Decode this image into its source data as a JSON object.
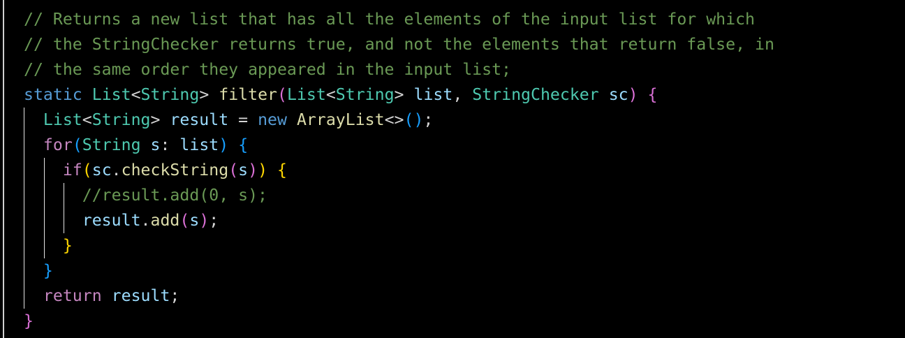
{
  "colors": {
    "background": "#000000",
    "comment": "#6a9955",
    "keyword": "#569cd6",
    "control": "#c586c0",
    "type": "#4ec9b0",
    "function": "#dcdcaa",
    "variable": "#9cdcfe",
    "plain": "#d4d4d4",
    "bracket_level_1": "#da70d6",
    "bracket_level_2": "#179fff",
    "bracket_level_3": "#ffd700"
  },
  "code": {
    "lines": [
      {
        "indent_guides": 0,
        "tokens": [
          {
            "t": "// Returns a new list that has all the elements of the input list for which",
            "c": "comment"
          }
        ]
      },
      {
        "indent_guides": 0,
        "tokens": [
          {
            "t": "// the StringChecker returns true, and not the elements that return false, in",
            "c": "comment"
          }
        ]
      },
      {
        "indent_guides": 0,
        "tokens": [
          {
            "t": "// the same order they appeared in the input list;",
            "c": "comment"
          }
        ]
      },
      {
        "indent_guides": 0,
        "tokens": [
          {
            "t": "static",
            "c": "keyword"
          },
          {
            "t": " ",
            "c": "plain"
          },
          {
            "t": "List",
            "c": "type"
          },
          {
            "t": "<",
            "c": "plain"
          },
          {
            "t": "String",
            "c": "type"
          },
          {
            "t": "> ",
            "c": "plain"
          },
          {
            "t": "filter",
            "c": "func"
          },
          {
            "t": "(",
            "c": "brace1"
          },
          {
            "t": "List",
            "c": "type"
          },
          {
            "t": "<",
            "c": "plain"
          },
          {
            "t": "String",
            "c": "type"
          },
          {
            "t": "> ",
            "c": "plain"
          },
          {
            "t": "list",
            "c": "variable"
          },
          {
            "t": ", ",
            "c": "plain"
          },
          {
            "t": "StringChecker",
            "c": "type"
          },
          {
            "t": " ",
            "c": "plain"
          },
          {
            "t": "sc",
            "c": "variable"
          },
          {
            "t": ")",
            "c": "brace1"
          },
          {
            "t": " ",
            "c": "plain"
          },
          {
            "t": "{",
            "c": "brace1"
          }
        ]
      },
      {
        "indent_guides": 1,
        "tokens": [
          {
            "t": "  ",
            "c": "plain"
          },
          {
            "t": "List",
            "c": "type"
          },
          {
            "t": "<",
            "c": "plain"
          },
          {
            "t": "String",
            "c": "type"
          },
          {
            "t": "> ",
            "c": "plain"
          },
          {
            "t": "result",
            "c": "variable"
          },
          {
            "t": " = ",
            "c": "plain"
          },
          {
            "t": "new",
            "c": "keyword"
          },
          {
            "t": " ",
            "c": "plain"
          },
          {
            "t": "ArrayList",
            "c": "func"
          },
          {
            "t": "<>",
            "c": "plain"
          },
          {
            "t": "()",
            "c": "brace2"
          },
          {
            "t": ";",
            "c": "plain"
          }
        ]
      },
      {
        "indent_guides": 1,
        "tokens": [
          {
            "t": "  ",
            "c": "plain"
          },
          {
            "t": "for",
            "c": "control"
          },
          {
            "t": "(",
            "c": "brace2"
          },
          {
            "t": "String",
            "c": "type"
          },
          {
            "t": " ",
            "c": "plain"
          },
          {
            "t": "s",
            "c": "variable"
          },
          {
            "t": ": ",
            "c": "plain"
          },
          {
            "t": "list",
            "c": "variable"
          },
          {
            "t": ")",
            "c": "brace2"
          },
          {
            "t": " ",
            "c": "plain"
          },
          {
            "t": "{",
            "c": "brace2"
          }
        ]
      },
      {
        "indent_guides": 2,
        "tokens": [
          {
            "t": "    ",
            "c": "plain"
          },
          {
            "t": "if",
            "c": "control"
          },
          {
            "t": "(",
            "c": "brace3"
          },
          {
            "t": "sc",
            "c": "variable"
          },
          {
            "t": ".",
            "c": "plain"
          },
          {
            "t": "checkString",
            "c": "func"
          },
          {
            "t": "(",
            "c": "brace1"
          },
          {
            "t": "s",
            "c": "variable"
          },
          {
            "t": ")",
            "c": "brace1"
          },
          {
            "t": ")",
            "c": "brace3"
          },
          {
            "t": " ",
            "c": "plain"
          },
          {
            "t": "{",
            "c": "brace3"
          }
        ]
      },
      {
        "indent_guides": 3,
        "tokens": [
          {
            "t": "      ",
            "c": "plain"
          },
          {
            "t": "//result.add(0, s);",
            "c": "comment"
          }
        ]
      },
      {
        "indent_guides": 3,
        "tokens": [
          {
            "t": "      ",
            "c": "plain"
          },
          {
            "t": "result",
            "c": "variable"
          },
          {
            "t": ".",
            "c": "plain"
          },
          {
            "t": "add",
            "c": "func"
          },
          {
            "t": "(",
            "c": "brace1"
          },
          {
            "t": "s",
            "c": "variable"
          },
          {
            "t": ")",
            "c": "brace1"
          },
          {
            "t": ";",
            "c": "plain"
          }
        ]
      },
      {
        "indent_guides": 2,
        "tokens": [
          {
            "t": "    ",
            "c": "plain"
          },
          {
            "t": "}",
            "c": "brace3"
          }
        ]
      },
      {
        "indent_guides": 1,
        "tokens": [
          {
            "t": "  ",
            "c": "plain"
          },
          {
            "t": "}",
            "c": "brace2"
          }
        ]
      },
      {
        "indent_guides": 1,
        "tokens": [
          {
            "t": "  ",
            "c": "plain"
          },
          {
            "t": "return",
            "c": "control"
          },
          {
            "t": " ",
            "c": "plain"
          },
          {
            "t": "result",
            "c": "variable"
          },
          {
            "t": ";",
            "c": "plain"
          }
        ]
      },
      {
        "indent_guides": 0,
        "tokens": [
          {
            "t": "}",
            "c": "brace1"
          }
        ]
      }
    ]
  }
}
